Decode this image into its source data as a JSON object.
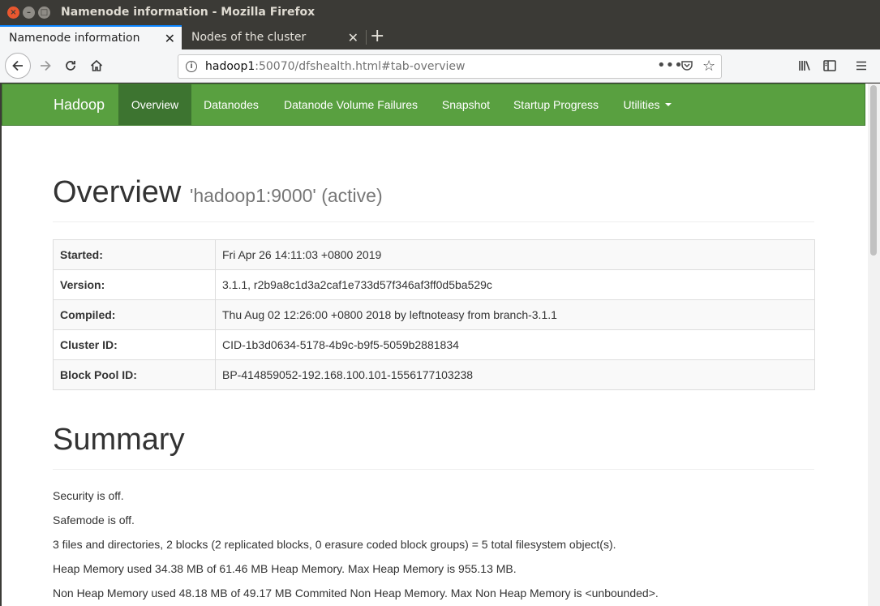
{
  "window": {
    "title": "Namenode information - Mozilla Firefox"
  },
  "tabs": [
    {
      "label": "Namenode information"
    },
    {
      "label": "Nodes of the cluster"
    }
  ],
  "urlbar": {
    "host": "hadoop1",
    "rest": ":50070/dfshealth.html#tab-overview"
  },
  "hadoop_nav": {
    "brand": "Hadoop",
    "items": [
      "Overview",
      "Datanodes",
      "Datanode Volume Failures",
      "Snapshot",
      "Startup Progress",
      "Utilities"
    ],
    "active": "Overview",
    "color": "#59a040"
  },
  "overview": {
    "title": "Overview",
    "subtitle": "'hadoop1:9000' (active)",
    "rows": [
      {
        "label": "Started:",
        "value": "Fri Apr 26 14:11:03 +0800 2019"
      },
      {
        "label": "Version:",
        "value": "3.1.1, r2b9a8c1d3a2caf1e733d57f346af3ff0d5ba529c"
      },
      {
        "label": "Compiled:",
        "value": "Thu Aug 02 12:26:00 +0800 2018 by leftnoteasy from branch-3.1.1"
      },
      {
        "label": "Cluster ID:",
        "value": "CID-1b3d0634-5178-4b9c-b9f5-5059b2881834"
      },
      {
        "label": "Block Pool ID:",
        "value": "BP-414859052-192.168.100.101-1556177103238"
      }
    ]
  },
  "summary": {
    "title": "Summary",
    "lines": [
      "Security is off.",
      "Safemode is off.",
      "3 files and directories, 2 blocks (2 replicated blocks, 0 erasure coded block groups) = 5 total filesystem object(s).",
      "Heap Memory used 34.38 MB of 61.46 MB Heap Memory. Max Heap Memory is 955.13 MB.",
      "Non Heap Memory used 48.18 MB of 49.17 MB Commited Non Heap Memory. Max Non Heap Memory is <unbounded>."
    ]
  }
}
